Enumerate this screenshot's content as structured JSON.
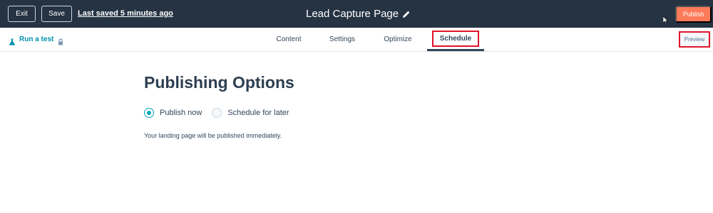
{
  "topbar": {
    "exit_label": "Exit",
    "save_label": "Save",
    "last_saved": "Last saved 5 minutes ago",
    "page_title": "Lead Capture Page",
    "publish_label": "Publish"
  },
  "navbar": {
    "run_test_label": "Run a test",
    "tabs": [
      {
        "label": "Content"
      },
      {
        "label": "Settings"
      },
      {
        "label": "Optimize"
      },
      {
        "label": "Schedule",
        "active": true
      }
    ],
    "preview_label": "Preview"
  },
  "main": {
    "heading": "Publishing Options",
    "options": [
      {
        "label": "Publish now",
        "selected": true
      },
      {
        "label": "Schedule for later",
        "selected": false
      }
    ],
    "help_text": "Your landing page will be published immediately."
  },
  "colors": {
    "topbar_bg": "#253342",
    "accent_publish": "#ff7a59",
    "radio_selected": "#00a4bd",
    "link_teal": "#0091ae",
    "highlight_red": "#e0142a"
  }
}
